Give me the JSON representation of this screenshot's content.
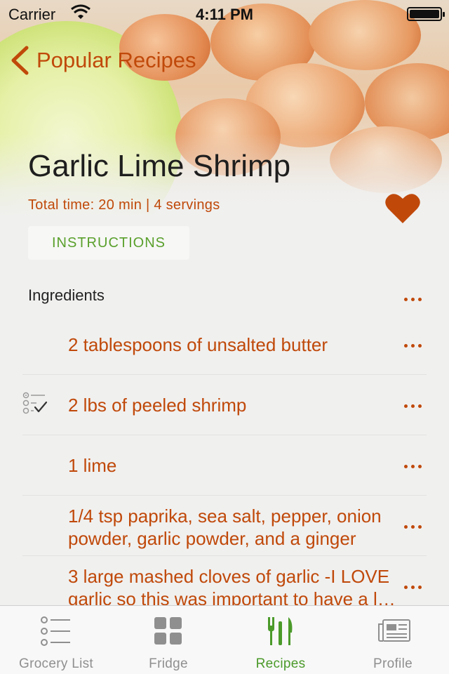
{
  "status_bar": {
    "carrier": "Carrier",
    "time": "4:11 PM"
  },
  "nav": {
    "back_label": "Popular Recipes"
  },
  "recipe": {
    "title": "Garlic Lime Shrimp",
    "meta": "Total time: 20 min | 4 servings",
    "favorited": true,
    "instructions_label": "INSTRUCTIONS"
  },
  "ingredients": {
    "header": "Ingredients",
    "items": [
      {
        "text": "2 tablespoons of unsalted butter",
        "checked": false
      },
      {
        "text": "2 lbs of peeled shrimp",
        "checked": true
      },
      {
        "text": "1 lime",
        "checked": false
      },
      {
        "text": "1/4 tsp paprika, sea salt, pepper, onion powder, garlic powder, and a ginger",
        "checked": false
      },
      {
        "text": "3 large mashed cloves of garlic -I LOVE garlic so this was important to have a l…",
        "checked": false
      }
    ]
  },
  "tabs": [
    {
      "label": "Grocery List",
      "icon": "list-icon",
      "active": false
    },
    {
      "label": "Fridge",
      "icon": "grid-icon",
      "active": false
    },
    {
      "label": "Recipes",
      "icon": "fork-knife-icon",
      "active": true
    },
    {
      "label": "Profile",
      "icon": "newspaper-icon",
      "active": false
    }
  ],
  "colors": {
    "accent": "#c0490a",
    "active_tab": "#4b9a2a",
    "instructions_text": "#5aa02c"
  }
}
